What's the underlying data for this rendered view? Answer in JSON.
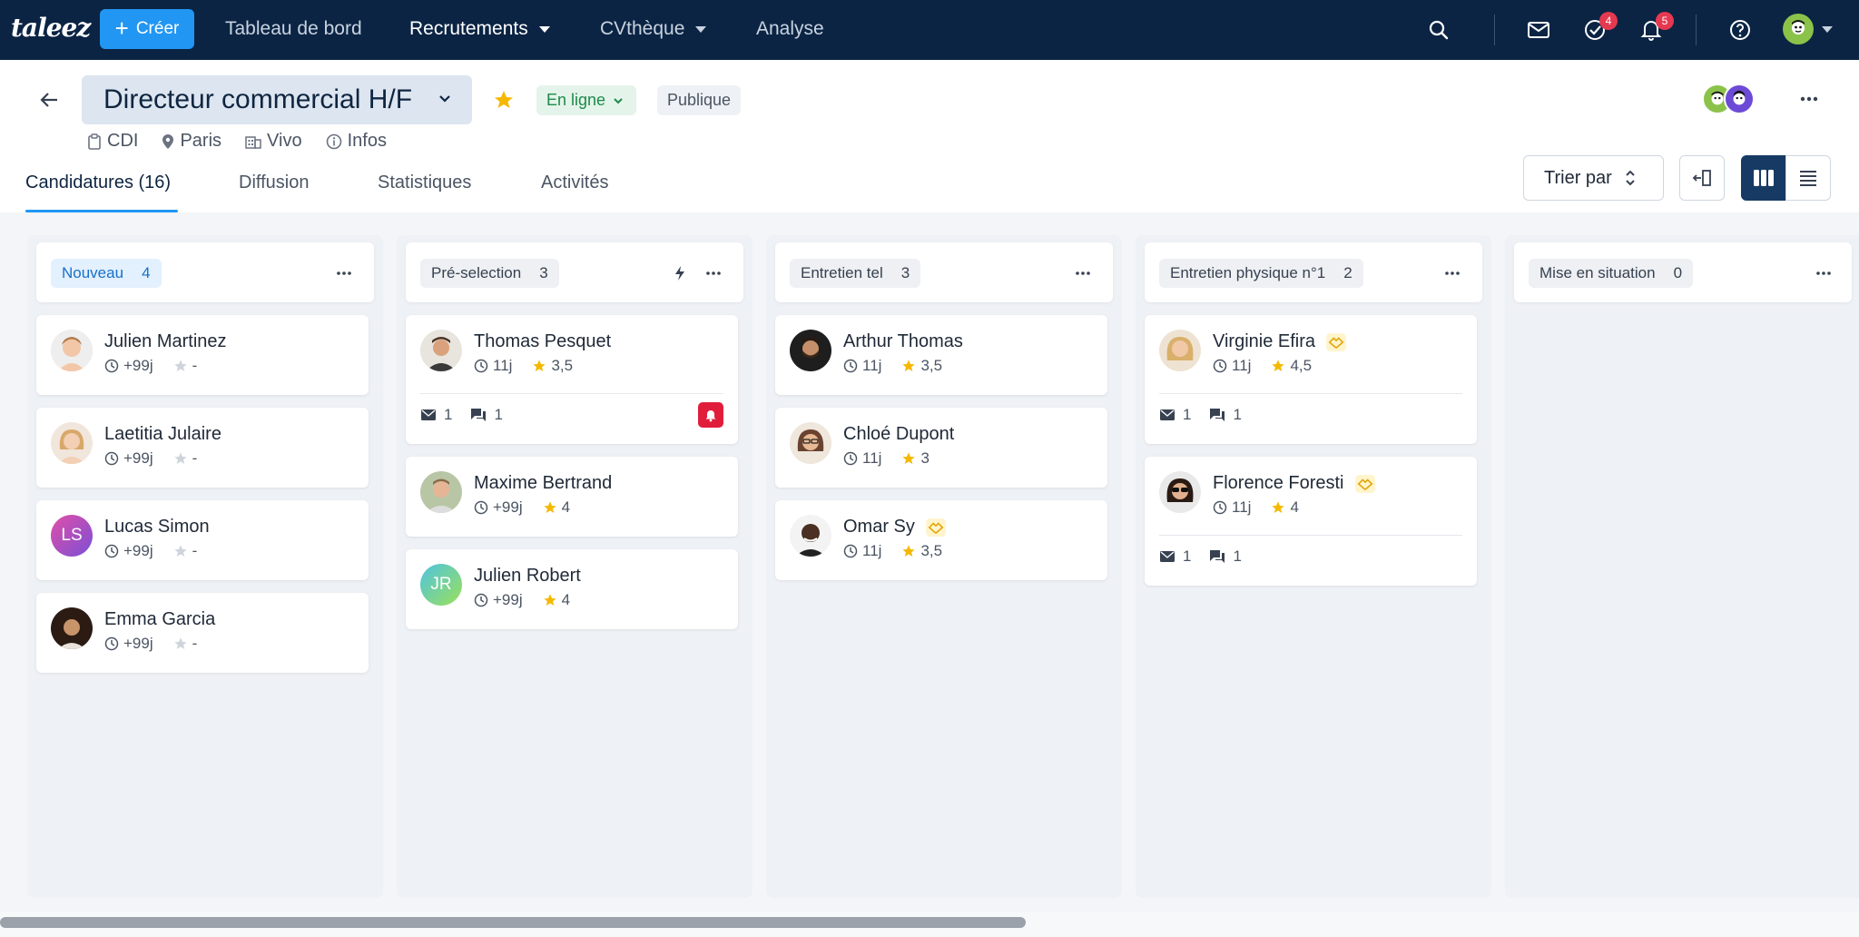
{
  "nav": {
    "logo": "taleez",
    "create_label": "Créer",
    "links": [
      "Tableau de bord",
      "Recrutements",
      "CVthèque",
      "Analyse"
    ],
    "tasks_badge": "4",
    "notifications_badge": "5"
  },
  "job": {
    "title": "Directeur commercial H/F",
    "status": "En ligne",
    "visibility": "Publique",
    "contract": "CDI",
    "location": "Paris",
    "company": "Vivo",
    "infos": "Infos"
  },
  "tabs": [
    "Candidatures (16)",
    "Diffusion",
    "Statistiques",
    "Activités"
  ],
  "toolbar": {
    "sort_label": "Trier par"
  },
  "columns": [
    {
      "name": "Nouveau",
      "count": "4",
      "cards": [
        {
          "name": "Julien Martinez",
          "age": "+99j",
          "rating": "-"
        },
        {
          "name": "Laetitia Julaire",
          "age": "+99j",
          "rating": "-"
        },
        {
          "name": "Lucas Simon",
          "initials": "LS",
          "age": "+99j",
          "rating": "-"
        },
        {
          "name": "Emma Garcia",
          "age": "+99j",
          "rating": "-"
        }
      ]
    },
    {
      "name": "Pré-selection",
      "count": "3",
      "cards": [
        {
          "name": "Thomas Pesquet",
          "age": "11j",
          "rating": "3,5",
          "emails": "1",
          "comments": "1"
        },
        {
          "name": "Maxime Bertrand",
          "age": "+99j",
          "rating": "4"
        },
        {
          "name": "Julien Robert",
          "initials": "JR",
          "age": "+99j",
          "rating": "4"
        }
      ]
    },
    {
      "name": "Entretien tel",
      "count": "3",
      "cards": [
        {
          "name": "Arthur Thomas",
          "age": "11j",
          "rating": "3,5"
        },
        {
          "name": "Chloé Dupont",
          "age": "11j",
          "rating": "3"
        },
        {
          "name": "Omar Sy",
          "age": "11j",
          "rating": "3,5"
        }
      ]
    },
    {
      "name": "Entretien physique n°1",
      "count": "2",
      "cards": [
        {
          "name": "Virginie Efira",
          "age": "11j",
          "rating": "4,5",
          "emails": "1",
          "comments": "1"
        },
        {
          "name": "Florence Foresti",
          "age": "11j",
          "rating": "4",
          "emails": "1",
          "comments": "1"
        }
      ]
    },
    {
      "name": "Mise en situation",
      "count": "0",
      "cards": []
    }
  ],
  "colors": {
    "nav_bg": "#0b2444",
    "accent": "#2196f3",
    "star": "#f5b800",
    "alert": "#e01e3c",
    "online_green": "#1e8a4a"
  }
}
